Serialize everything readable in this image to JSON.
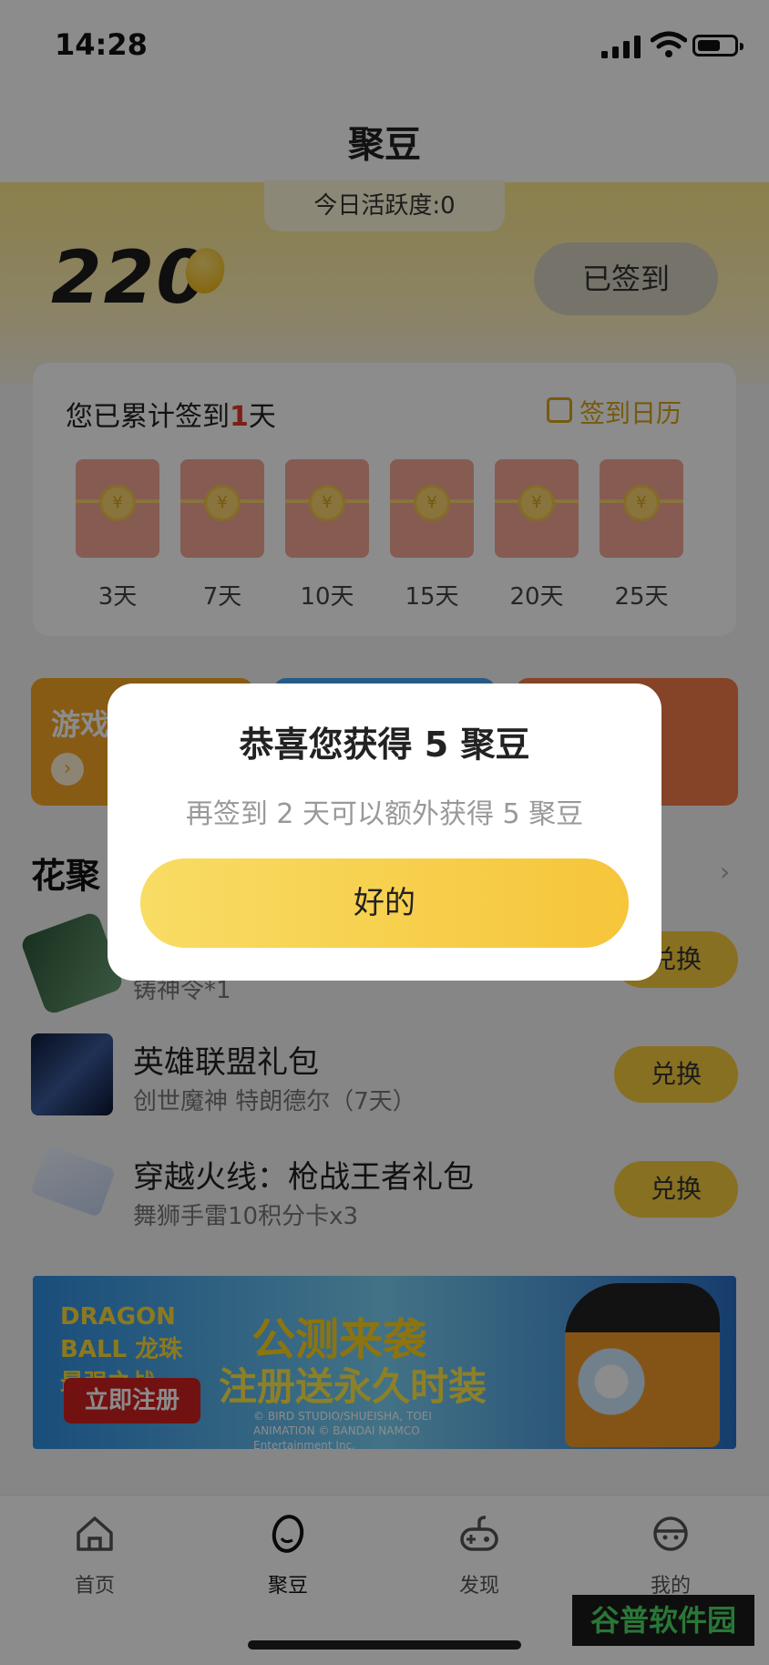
{
  "status_bar": {
    "time": "14:28"
  },
  "header": {
    "title": "聚豆"
  },
  "hero": {
    "activity_label": "今日活跃度:0",
    "balance": "220",
    "signed_label": "已签到"
  },
  "signin_card": {
    "streak_prefix": "您已累计签到",
    "streak_days": "1",
    "streak_suffix": "天",
    "calendar_label": "签到日历",
    "milestones": [
      "3天",
      "7天",
      "10天",
      "15天",
      "20天",
      "25天"
    ],
    "coin_glyph": "¥"
  },
  "promos": {
    "first_label": "游戏"
  },
  "section": {
    "title": "花聚",
    "more": "›"
  },
  "items": [
    {
      "name": "",
      "sub": "铸神令*1",
      "button": "兑换"
    },
    {
      "name": "英雄联盟礼包",
      "sub": "创世魔神 特朗德尔（7天）",
      "button": "兑换"
    },
    {
      "name": "穿越火线：枪战王者礼包",
      "sub": "舞狮手雷10积分卡x3",
      "button": "兑换"
    }
  ],
  "banner": {
    "logo": "DRAGON BALL 龙珠最强之战",
    "title1": "公测来袭",
    "title2": "注册送永久时装",
    "cta": "立即注册",
    "credit": "© BIRD STUDIO/SHUEISHA, TOEI ANIMATION © BANDAI NAMCO Entertainment Inc."
  },
  "tabbar": {
    "tabs": [
      {
        "label": "首页",
        "icon": "home-icon"
      },
      {
        "label": "聚豆",
        "icon": "bean-icon"
      },
      {
        "label": "发现",
        "icon": "gamepad-icon"
      },
      {
        "label": "我的",
        "icon": "profile-icon"
      }
    ],
    "watermark": "谷普软件园"
  },
  "modal": {
    "title": "恭喜您获得 5 聚豆",
    "message": "再签到 2 天可以额外获得 5 聚豆",
    "ok_label": "好的"
  }
}
